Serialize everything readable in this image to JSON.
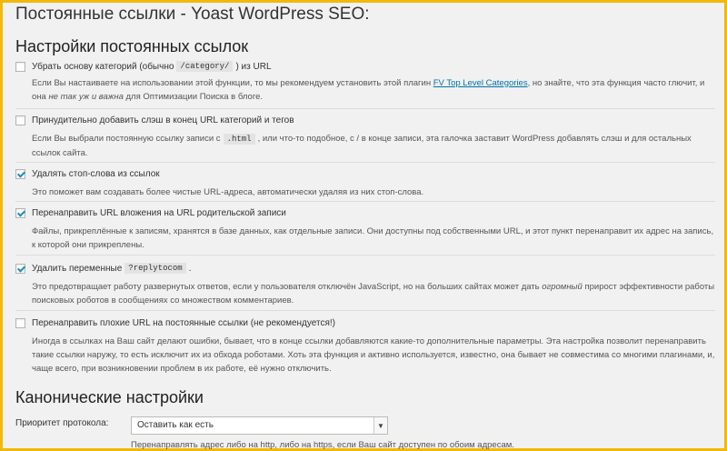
{
  "page_title": "Постоянные ссылки - Yoast WordPress SEO:",
  "section_permalinks": "Настройки постоянных ссылок",
  "section_canonical": "Канонические настройки",
  "options": [
    {
      "label": "Убрать основу категорий (обычно",
      "code": "/category/",
      "label_after": ") из URL",
      "checked": false,
      "desc_before": "Если Вы настаиваете на использовании этой функции, то мы рекомендуем установить этой плагин ",
      "desc_link": "FV Top Level Categories",
      "desc_mid": ", но знайте, что эта функция часто глючит, и она ",
      "desc_em": "не так уж и важна",
      "desc_after": " для Оптимизации Поиска в блоге."
    },
    {
      "label": "Принудительно добавить слэш в конец URL категорий и тегов",
      "checked": false,
      "desc_before": "Если Вы выбрали постоянную ссылку записи с",
      "desc_code": ".html",
      "desc_after": ", или что-то подобное, с / в конце записи, эта галочка заставит WordPress добавлять слэш и для остальных ссылок сайта."
    },
    {
      "label": "Удалять стоп-слова из ссылок",
      "checked": true,
      "desc": "Это поможет вам создавать более чистые URL-адреса, автоматически удаляя из них стоп-слова."
    },
    {
      "label": "Перенаправить URL вложения на URL родительской записи",
      "checked": true,
      "desc": "Файлы, прикреплённые к записям, хранятся в базе данных, как отдельные записи. Они доступны под собственными URL, и этот пункт перенаправит их адрес на запись, к которой они прикреплены."
    },
    {
      "label": "Удалить переменные",
      "code": "?replytocom",
      "label_after": ".",
      "checked": true,
      "desc_before": "Это предотвращает работу развернутых ответов, если у пользователя отключён JavaScript, но на больших сайтах может дать ",
      "desc_em": "огромный",
      "desc_after": " прирост эффективности работы поисковых роботов в сообщениях со множеством комментариев."
    },
    {
      "label": "Перенаправить плохие URL на постоянные ссылки (не рекомендуется!)",
      "checked": false,
      "desc": "Иногда в ссылках на Ваш сайт делают ошибки, бывает, что в конце ссылки добавляются какие-то дополнительные параметры. Эта настройка позволит перенаправить такие ссылки наружу, то есть исключит их из обхода роботами. Хоть эта функция и активно используется, известно, она бывает не совместима со многими плагинами, и, чаще всего, при возникновении проблем в их работе, её нужно отключить."
    }
  ],
  "protocol": {
    "label": "Приоритет протокола:",
    "selected": "Оставить как есть",
    "desc": "Перенаправлять адрес либо на http, либо на https, если Ваш сайт доступен по обоим адресам."
  }
}
